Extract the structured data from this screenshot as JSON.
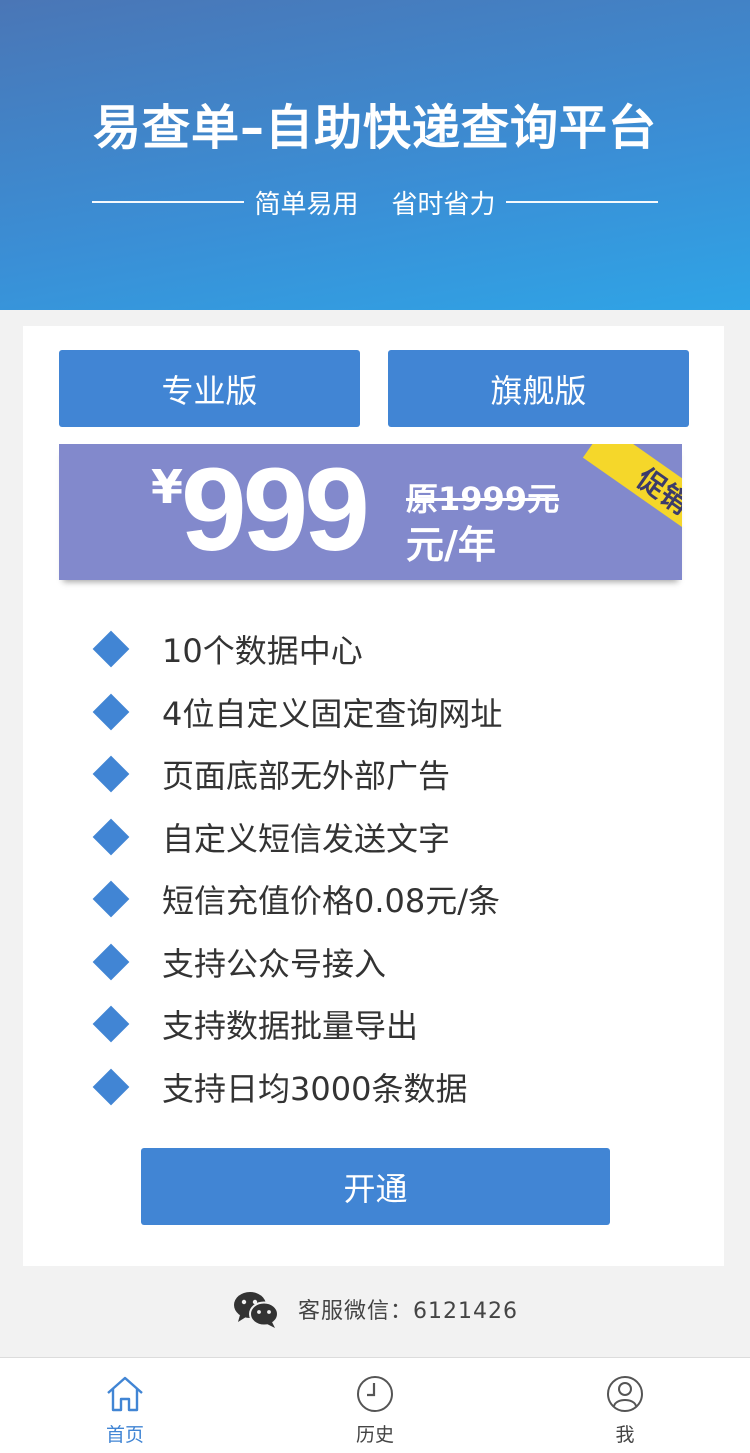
{
  "header": {
    "title": "易查单–自助快递查询平台",
    "subtitle": "简单易用    省时省力"
  },
  "plans": {
    "tabs": [
      {
        "label": "专业版"
      },
      {
        "label": "旗舰版"
      }
    ],
    "price": {
      "currency": "¥",
      "amount": "999",
      "original": "原1999元",
      "unit": "元/年",
      "promo_badge": "促销"
    },
    "features": [
      "10个数据中心",
      "4位自定义固定查询网址",
      "页面底部无外部广告",
      "自定义短信发送文字",
      "短信充值价格0.08元/条",
      "支持公众号接入",
      "支持数据批量导出",
      "支持日均3000条数据"
    ],
    "open_button": "开通"
  },
  "service": {
    "icon": "wechat-icon",
    "text": "客服微信：6121426"
  },
  "tabbar": {
    "items": [
      {
        "label": "首页",
        "icon": "home-icon",
        "active": true
      },
      {
        "label": "历史",
        "icon": "clock-icon",
        "active": false
      },
      {
        "label": "我",
        "icon": "user-icon",
        "active": false
      }
    ]
  },
  "colors": {
    "accent": "#4185d4",
    "price_panel": "#8289cc",
    "promo": "#f5d72a"
  }
}
